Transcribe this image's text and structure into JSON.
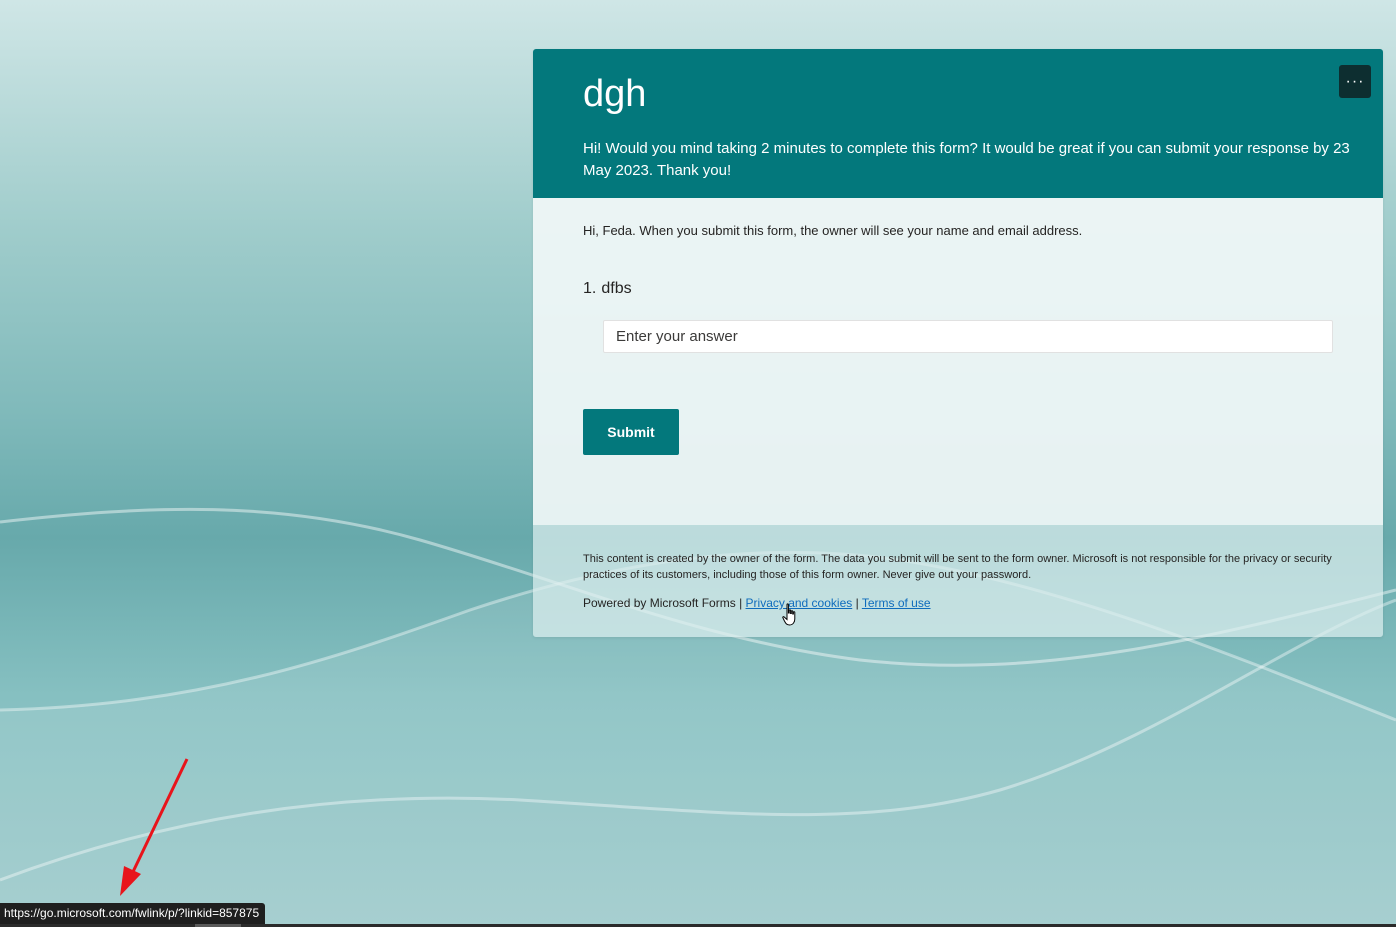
{
  "form": {
    "title": "dgh",
    "description": "Hi! Would you mind taking 2 minutes to complete this form? It would be great if you can submit your response by 23 May 2023. Thank you!",
    "more_options_label": "···",
    "identity_note": "Hi, Feda. When you submit this form, the owner will see your name and email address.",
    "question": {
      "number": "1.",
      "text": "dfbs",
      "placeholder": "Enter your answer",
      "value": ""
    },
    "submit_label": "Submit"
  },
  "footer": {
    "disclaimer": "This content is created by the owner of the form. The data you submit will be sent to the form owner. Microsoft is not responsible for the privacy or security practices of its customers, including those of this form owner. Never give out your password.",
    "powered_by": "Powered by Microsoft Forms",
    "separator": "|",
    "privacy_link": "Privacy and cookies",
    "terms_link": "Terms of use"
  },
  "status_bar": {
    "url": "https://go.microsoft.com/fwlink/p/?linkid=857875"
  },
  "colors": {
    "brand": "#03787c",
    "more_button": "#0d2e30",
    "link": "#0f6cbd",
    "annotation_arrow": "#e8141b"
  },
  "icons": {
    "cursor": "hand-pointer-icon",
    "annotation": "red-arrow-icon"
  }
}
